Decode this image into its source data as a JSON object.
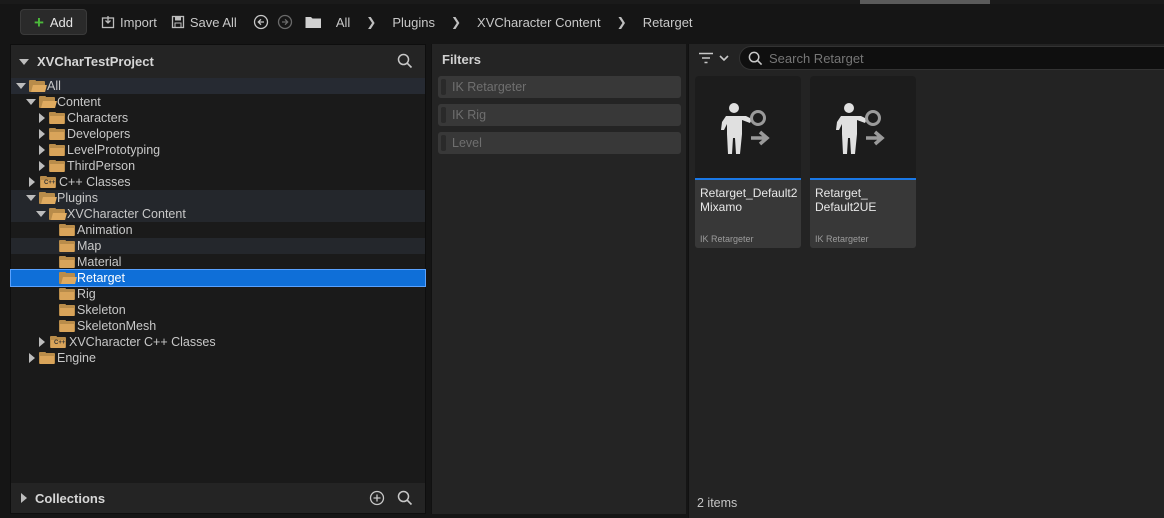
{
  "toolbar": {
    "add_label": "Add",
    "import_label": "Import",
    "save_all_label": "Save All"
  },
  "breadcrumbs": [
    "All",
    "Plugins",
    "XVCharacter Content",
    "Retarget"
  ],
  "tree_panel": {
    "title": "XVCharTestProject",
    "items": [
      {
        "label": "All"
      },
      {
        "label": "Content"
      },
      {
        "label": "Characters"
      },
      {
        "label": "Developers"
      },
      {
        "label": "LevelPrototyping"
      },
      {
        "label": "ThirdPerson"
      },
      {
        "label": "C++ Classes"
      },
      {
        "label": "Plugins"
      },
      {
        "label": "XVCharacter Content"
      },
      {
        "label": "Animation"
      },
      {
        "label": "Map"
      },
      {
        "label": "Material"
      },
      {
        "label": "Retarget"
      },
      {
        "label": "Rig"
      },
      {
        "label": "Skeleton"
      },
      {
        "label": "SkeletonMesh"
      },
      {
        "label": "XVCharacter C++ Classes"
      },
      {
        "label": "Engine"
      }
    ],
    "collections_label": "Collections"
  },
  "filters": {
    "title": "Filters",
    "items": [
      "IK Retargeter",
      "IK Rig",
      "Level"
    ]
  },
  "content": {
    "search_placeholder": "Search Retarget",
    "assets": [
      {
        "name": "Retarget_Default2\nMixamo",
        "type": "IK Retargeter"
      },
      {
        "name": "Retarget_\nDefault2UE",
        "type": "IK Retargeter"
      }
    ],
    "items_count": "2 items"
  },
  "colors": {
    "selection": "#0f6fd8",
    "folder": "#d9a45a",
    "add_plus": "#4cba3b",
    "asset_underline": "#1a78e6"
  }
}
